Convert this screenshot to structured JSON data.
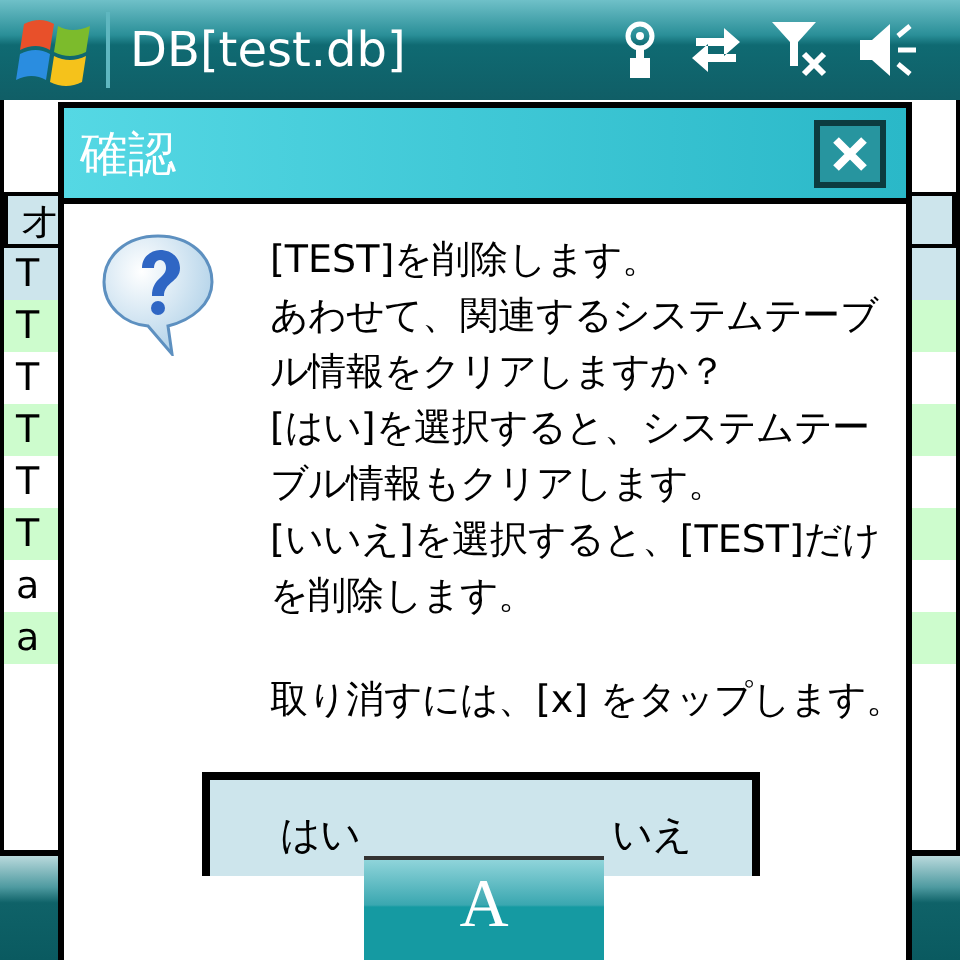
{
  "title_bar": {
    "title": "DB[test.db]"
  },
  "table": {
    "header": "オ",
    "rows": [
      {
        "cell": "T",
        "selected": true
      },
      {
        "cell": "T",
        "selected": false
      },
      {
        "cell": "T",
        "selected": false
      },
      {
        "cell": "T",
        "selected": false
      },
      {
        "cell": "T",
        "selected": false
      },
      {
        "cell": "T",
        "selected": false
      },
      {
        "cell": "a",
        "selected": false
      },
      {
        "cell": "a",
        "selected": false
      }
    ]
  },
  "dialog": {
    "title": "確認",
    "paragraphs": [
      "[TEST]を削除します。",
      "あわせて、関連するシステムテーブル情報をクリアしますか？",
      "[はい]を選択すると、システムテーブル情報もクリアします。",
      "[いいえ]を選択すると、[TEST]だけを削除します。",
      "取り消すには、[x] をタップします。"
    ],
    "buttons": [
      "はい",
      "いえ"
    ]
  },
  "input_panel": {
    "label": "A"
  }
}
